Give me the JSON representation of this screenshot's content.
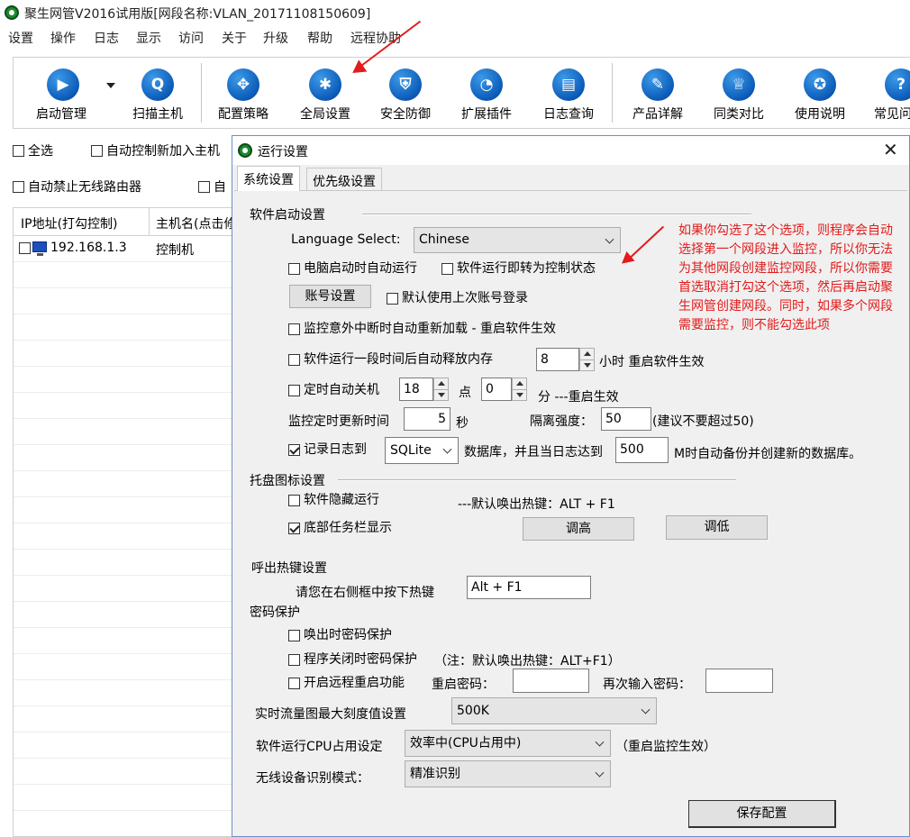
{
  "app": {
    "title": "聚生网管V2016试用版[网段名称:VLAN_20171108150609]"
  },
  "menu": [
    "设置",
    "操作",
    "日志",
    "显示",
    "访问",
    "关于",
    "升级",
    "帮助",
    "远程协助"
  ],
  "toolbar": {
    "buttons": [
      {
        "label": "启动管理",
        "icon": "play-icon"
      },
      {
        "label": "扫描主机",
        "icon": "magnifier-icon"
      },
      {
        "label": "配置策略",
        "icon": "move-arrows-icon"
      },
      {
        "label": "全局设置",
        "icon": "gear-icon"
      },
      {
        "label": "安全防御",
        "icon": "shield-icon"
      },
      {
        "label": "扩展插件",
        "icon": "pie-chart-icon"
      },
      {
        "label": "日志查询",
        "icon": "notebook-icon"
      },
      {
        "label": "产品详解",
        "icon": "document-pen-icon"
      },
      {
        "label": "同类对比",
        "icon": "graduation-cap-icon"
      },
      {
        "label": "使用说明",
        "icon": "ribbon-icon"
      },
      {
        "label": "常见问",
        "icon": "question-icon"
      }
    ]
  },
  "left": {
    "select_all": "全选",
    "auto_control_new": "自动控制新加入主机",
    "auto_block_wifi": "自动禁止无线路由器",
    "auto_partial": "自",
    "columns": [
      "IP地址(打勾控制)",
      "主机名(点击修"
    ],
    "rows": [
      {
        "ip": "192.168.1.3",
        "name": "控制机",
        "checked": false
      }
    ]
  },
  "dialog": {
    "title": "运行设置",
    "tabs": [
      "系统设置",
      "优先级设置"
    ],
    "software_startup": {
      "heading": "软件启动设置",
      "language_label": "Language Select:",
      "language_value": "Chinese",
      "auto_start": "电脑启动时自动运行",
      "auto_control": "软件运行即转为控制状态",
      "account_button": "账号设置",
      "use_last_account": "默认使用上次账号登录",
      "auto_reload": "监控意外中断时自动重新加载 - 重启软件生效",
      "auto_release": "软件运行一段时间后自动释放内存",
      "release_hours": "8",
      "release_suffix": "小时  重启软件生效",
      "auto_shutdown": "定时自动关机",
      "shutdown_hour": "18",
      "hour_unit": "点",
      "shutdown_min": "0",
      "min_suffix": "分 ---重启生效",
      "refresh_label": "监控定时更新时间",
      "refresh_value": "5",
      "refresh_unit": "秒",
      "isolation_label": "隔离强度：",
      "isolation_value": "50",
      "isolation_hint": "(建议不要超过50)",
      "log_to": "记录日志到",
      "log_db": "SQLite",
      "log_mid": "数据库，并且当日志达到",
      "log_size": "500",
      "log_suffix": "M时自动备份并创建新的数据库。"
    },
    "tray": {
      "heading": "托盘图标设置",
      "hide_running": "软件隐藏运行",
      "hotkey_hint": "---默认唤出热键：ALT + F1",
      "taskbar_show": "底部任务栏显示",
      "raise_button": "调高",
      "lower_button": "调低"
    },
    "hotkey": {
      "heading": "呼出热键设置",
      "prompt": "请您在右侧框中按下热键",
      "value": "Alt + F1"
    },
    "password": {
      "heading": "密码保护",
      "on_wake": "唤出时密码保护",
      "on_close": "程序关闭时密码保护",
      "close_note": "（注：默认唤出热键：ALT+F1）",
      "remote_restart": "开启远程重启功能",
      "restart_pwd_label": "重启密码：",
      "restart_pwd_value": "",
      "confirm_pwd_label": "再次输入密码：",
      "confirm_pwd_value": ""
    },
    "traffic_label": "实时流量图最大刻度值设置",
    "traffic_value": "500K",
    "cpu_label": "软件运行CPU占用设定",
    "cpu_value": "效率中(CPU占用中)",
    "cpu_note": "（重启监控生效）",
    "wireless_label": "无线设备识别模式：",
    "wireless_value": "精准识别",
    "save_button": "保存配置"
  },
  "annotation": "如果你勾选了这个选项，则程序会自动选择第一个网段进入监控，所以你无法为其他网段创建监控网段，所以你需要首选取消打勾这个选项，然后再启动聚生网管创建网段。同时，如果多个网段需要监控，则不能勾选此项",
  "colors": {
    "accent_blue": "#0b5bb8",
    "annotation_red": "#e21b1b",
    "dialog_bg": "#f0f0f0"
  }
}
